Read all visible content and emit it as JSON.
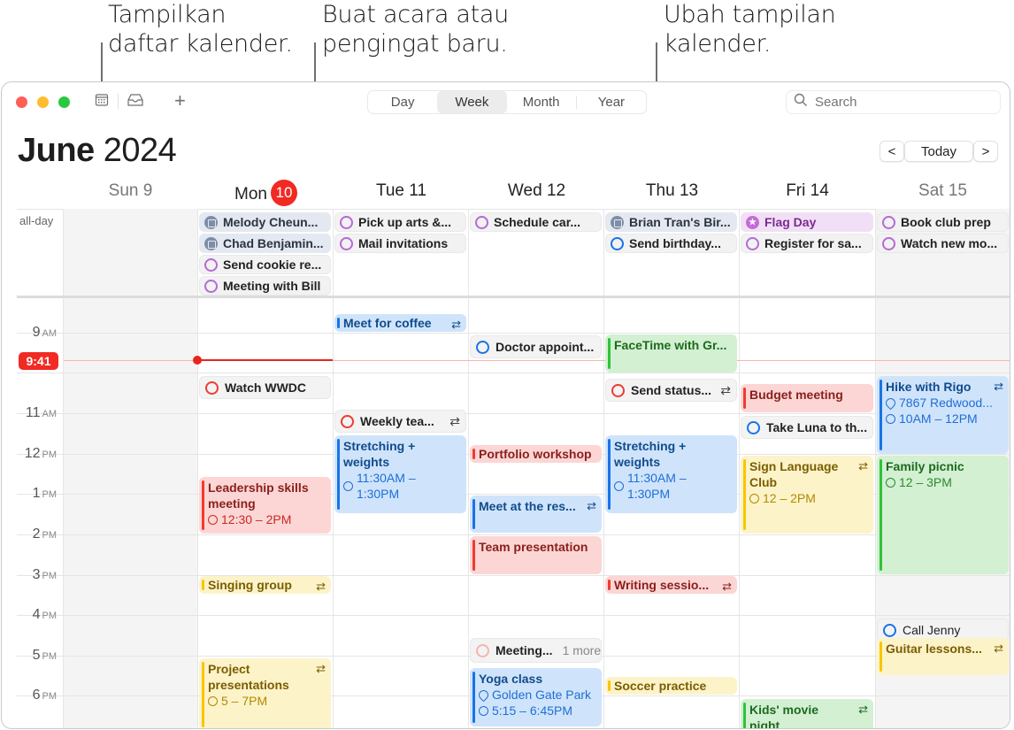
{
  "callouts": {
    "calendar_list": [
      "Tampilkan",
      "daftar kalender."
    ],
    "new_event": [
      "Buat acara atau",
      "pengingat baru."
    ],
    "change_view": [
      "Ubah tampilan",
      "kalender."
    ]
  },
  "toolbar": {
    "view_options": [
      "Day",
      "Week",
      "Month",
      "Year"
    ],
    "active_view": "Week",
    "add_label": "+",
    "search_placeholder": "Search"
  },
  "header": {
    "month": "June",
    "year": "2024",
    "today_label": "Today",
    "prev_label": "<",
    "next_label": ">"
  },
  "days": [
    {
      "name": "Sun",
      "num": "9",
      "weekend": true
    },
    {
      "name": "Mon",
      "num": "10",
      "today": true
    },
    {
      "name": "Tue",
      "num": "11"
    },
    {
      "name": "Wed",
      "num": "12"
    },
    {
      "name": "Thu",
      "num": "13"
    },
    {
      "name": "Fri",
      "num": "14"
    },
    {
      "name": "Sat",
      "num": "15",
      "weekend": true
    }
  ],
  "allday_label": "all-day",
  "hours": [
    {
      "h": "9",
      "ap": "AM"
    },
    {
      "h": "11",
      "ap": "AM"
    },
    {
      "h": "12",
      "ap": "PM"
    },
    {
      "h": "1",
      "ap": "PM"
    },
    {
      "h": "2",
      "ap": "PM"
    },
    {
      "h": "3",
      "ap": "PM"
    },
    {
      "h": "4",
      "ap": "PM"
    },
    {
      "h": "5",
      "ap": "PM"
    },
    {
      "h": "6",
      "ap": "PM"
    }
  ],
  "current_time": "9:41",
  "allday": {
    "mon": [
      "Melody Cheun...",
      "Chad Benjamin...",
      "Send cookie re...",
      "Meeting with Bill"
    ],
    "tue": [
      "Pick up arts &...",
      "Mail invitations"
    ],
    "wed": [
      "Schedule car..."
    ],
    "thu": [
      "Brian Tran's Bir...",
      "Send birthday..."
    ],
    "fri": [
      "Flag Day",
      "Register for sa..."
    ],
    "sat": [
      "Book club prep",
      "Watch new mo..."
    ]
  },
  "events": {
    "meet_coffee": "Meet for coffee",
    "watch_wwdc": "Watch WWDC",
    "weekly_team": "Weekly tea...",
    "stretching": "Stretching + weights",
    "stretching_time": "11:30AM – 1:30PM",
    "leadership": "Leadership skills meeting",
    "leadership_time": "12:30 – 2PM",
    "singing": "Singing group",
    "project": "Project presentations",
    "project_time": "5 – 7PM",
    "doctor": "Doctor appoint...",
    "portfolio": "Portfolio workshop",
    "meet_rest": "Meet at the res...",
    "team_pres": "Team presentation",
    "meeting_more": "Meeting...",
    "more_label": "1 more",
    "yoga": "Yoga class",
    "yoga_loc": "Golden Gate Park",
    "yoga_time": "5:15 – 6:45PM",
    "facetime": "FaceTime with Gr...",
    "send_status": "Send status...",
    "writing": "Writing sessio...",
    "soccer": "Soccer practice",
    "budget": "Budget meeting",
    "luna": "Take Luna to th...",
    "sign_lang": "Sign Language Club",
    "sign_time": "12 – 2PM",
    "kids_movie": "Kids' movie night",
    "hike": "Hike with Rigo",
    "hike_loc": "7867 Redwood...",
    "hike_time": "10AM – 12PM",
    "picnic": "Family picnic",
    "picnic_time": "12 – 3PM",
    "call_jenny": "Call Jenny",
    "guitar": "Guitar lessons..."
  },
  "colors": {
    "today_red": "#f12a23",
    "blue": "#1a73e8",
    "red": "#ef3b30",
    "yellow": "#f7c600",
    "green": "#31c23a",
    "purple": "#b56ad6"
  }
}
